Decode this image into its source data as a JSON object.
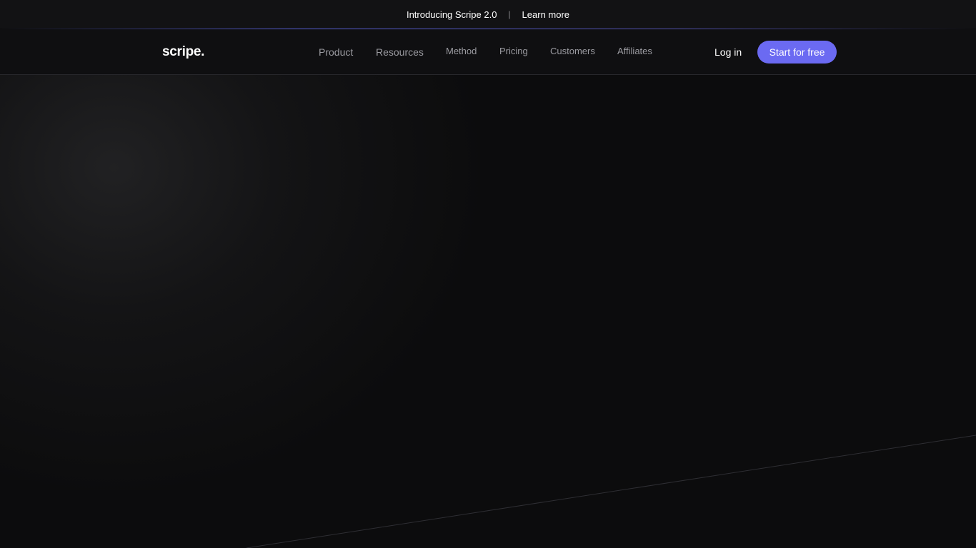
{
  "announcement": {
    "text": "Introducing Scripe 2.0",
    "separator": "|",
    "link_label": "Learn more"
  },
  "brand": {
    "name": "scripe.",
    "logo_icon": "soundwave-icon",
    "accent_color": "#6b6af2"
  },
  "nav": {
    "items": [
      {
        "label": "Product"
      },
      {
        "label": "Resources"
      },
      {
        "label": "Method"
      },
      {
        "label": "Pricing"
      },
      {
        "label": "Customers"
      },
      {
        "label": "Affiliates"
      }
    ],
    "login_label": "Log in",
    "cta_label": "Start for free"
  },
  "colors": {
    "background": "#0c0c0d",
    "nav_text": "#9b9ba1",
    "cta": "#6b6af2"
  }
}
